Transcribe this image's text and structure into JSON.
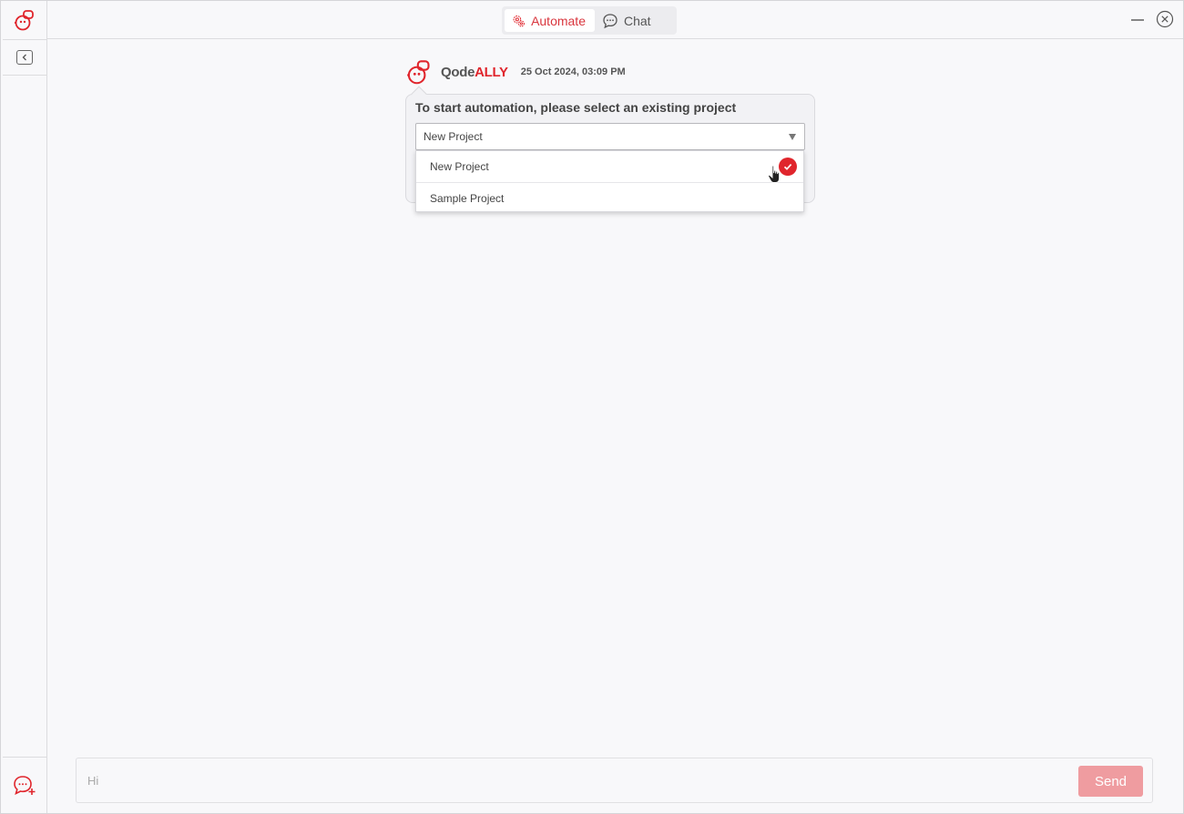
{
  "app": {
    "brand_part1": "Qode",
    "brand_part2": "ALLY",
    "accent_color": "#e0252c"
  },
  "topbar": {
    "tabs": [
      {
        "label": "Automate",
        "icon": "automate-gear-icon",
        "active": true
      },
      {
        "label": "Chat",
        "icon": "chat-bubble-icon",
        "active": false
      }
    ],
    "controls": [
      "minimize-icon",
      "close-icon"
    ]
  },
  "sidebar": {
    "top_icon": "qodeally-logo-icon",
    "collapse_icon": "collapse-sidebar-icon",
    "bottom_icon": "new-chat-icon"
  },
  "message": {
    "timestamp": "25 Oct 2024, 03:09 PM",
    "prompt": "To start automation, please select an existing project",
    "select": {
      "selected": "New Project",
      "options": [
        "New Project",
        "Sample Project"
      ]
    }
  },
  "composer": {
    "placeholder": "Hi",
    "send_label": "Send"
  }
}
